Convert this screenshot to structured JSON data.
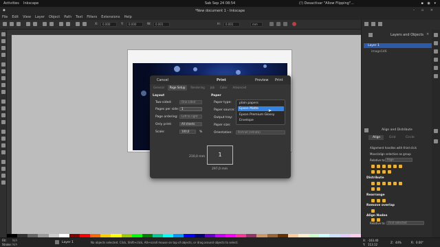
{
  "topbar": {
    "activities": "Activities",
    "app": "Inkscape",
    "clock": "Sab Sep 24  08:54",
    "notification": "(!) Desactivar \"Allow Flipping\"..."
  },
  "window": {
    "title": "*New document 1 - Inkscape"
  },
  "menu": [
    "File",
    "Edit",
    "View",
    "Layer",
    "Object",
    "Path",
    "Text",
    "Filters",
    "Extensions",
    "Help"
  ],
  "toolbar": {
    "x": "X:",
    "x_val": "0.000",
    "y": "Y:",
    "y_val": "0.000",
    "w": "W:",
    "w_val": "0.001",
    "h": "H:",
    "h_val": "0.001",
    "unit": "mm"
  },
  "layers": {
    "title": "Layers and Objects",
    "layer": "Layer 1",
    "image": "image146"
  },
  "align": {
    "tab_title": "Align and Distribute",
    "tabs": [
      "Align",
      "Grid",
      "Circle"
    ],
    "hint1": "Alignment handles with third click",
    "hint2": "Move/align selection as group",
    "relative_label": "Relative to:",
    "relative_value": "Page",
    "distribute": "Distribute",
    "rearrange": "Rearrange",
    "remove_overlap": "Remove overlap",
    "align_nodes": "Align Nodes",
    "nodes_relative_label": "Relative to:",
    "nodes_relative_value": "First selected"
  },
  "status": {
    "fill": "Fill:",
    "fill_val": "N/A",
    "stroke": "Stroke:",
    "stroke_val": "N/A",
    "layer": "Layer 1",
    "message": "No objects selected. Click, Shift+click, Alt+scroll mouse on top of objects, or drag around objects to select.",
    "x": "X:",
    "x_val": "-163.40",
    "y": "Y:",
    "y_val": "113.12",
    "zoom_label": "Z:",
    "zoom": "44%",
    "rot_label": "R:",
    "rot": "0.00°"
  },
  "dialog": {
    "cancel": "Cancel",
    "title": "Print",
    "preview": "Preview",
    "print": "Print",
    "tabs": [
      "General",
      "Page Setup",
      "Rendering",
      "Job",
      "Color",
      "Advanced"
    ],
    "active_tab": "Page Setup",
    "layout": {
      "heading": "Layout",
      "two_sided": "Two-sided:",
      "two_sided_val": "One sided",
      "pages_per_side": "Pages per side:",
      "pages_per_side_val": "1",
      "page_ordering": "Page ordering:",
      "page_ordering_val": "Left to right",
      "only_print": "Only print:",
      "only_print_val": "All sheets",
      "scale": "Scale:",
      "scale_val": "100,0",
      "scale_unit": "%"
    },
    "paper": {
      "heading": "Paper",
      "type": "Paper type:",
      "source": "Paper source:",
      "tray": "Output tray:",
      "size": "Paper size:",
      "orientation": "Orientation:",
      "orientation_val": "Portrait (retrato)"
    },
    "options": [
      "plain papers",
      "Epson Matte",
      "Epson Premium Glossy",
      "Envelope"
    ],
    "selected_option": "Epson Matte",
    "preview_page": "1",
    "width_label": "210,0 mm",
    "height_label": "297,0 mm"
  }
}
